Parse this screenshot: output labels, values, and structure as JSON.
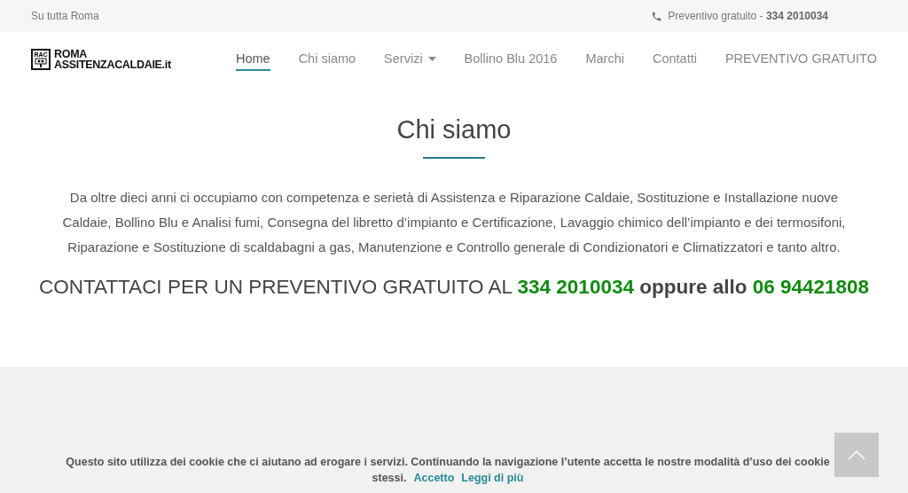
{
  "top_bar": {
    "area": "Su tutta Roma",
    "quote_label": "Preventivo gratuito - ",
    "quote_phone": "334 2010034"
  },
  "logo": {
    "badge": "RAC",
    "line_1": "ROMA",
    "line_2": "ASSITENZACALDAIE.it"
  },
  "nav": [
    {
      "label": "Home",
      "selected": true,
      "dropdown": false
    },
    {
      "label": "Chi siamo",
      "selected": false,
      "dropdown": false
    },
    {
      "label": "Servizi",
      "selected": false,
      "dropdown": true
    },
    {
      "label": "Bollino Blu 2016",
      "selected": false,
      "dropdown": false
    },
    {
      "label": "Marchi",
      "selected": false,
      "dropdown": false
    },
    {
      "label": "Contatti",
      "selected": false,
      "dropdown": false
    },
    {
      "label": "PREVENTIVO GRATUITO",
      "selected": false,
      "dropdown": false
    }
  ],
  "section": {
    "title": "Chi siamo",
    "text": "Da oltre dieci anni ci occupiamo con competenza e serietà di Assistenza e Riparazione Caldaie, Sostituzione e Installazione nuove Caldaie, Bollino Blu e Analisi fumi, Consegna del libretto d’impianto e Certificazione, Lavaggio chimico dell’impianto e dei termosifoni, Riparazione e Sostituzione di scaldabagni a gas, Manutenzione e Controllo generale di Condizionatori e Climatizzatori e tanto altro.",
    "cta": [
      {
        "kind": "plain",
        "text": "CONTATTACI PER UN PREVENTIVO GRATUITO AL "
      },
      {
        "kind": "phone",
        "text": "334 2010034"
      },
      {
        "kind": "bold",
        "text": " oppure allo "
      },
      {
        "kind": "phone",
        "text": "06 94421808"
      }
    ]
  },
  "cookie_bar": {
    "text": "Questo sito utilizza dei cookie che ci aiutano ad erogare i servizi. Continuando la navigazione l’utente accetta le nostre modalità d’uso dei cookie stessi.",
    "accept": "Accetto",
    "more": "Leggi di più"
  }
}
